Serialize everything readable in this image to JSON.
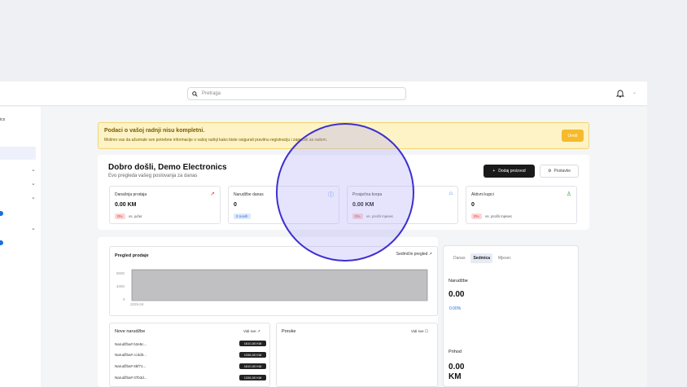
{
  "header": {
    "search_placeholder": "Pretraga",
    "search_icon": "search-icon",
    "bell_icon": "bell-icon",
    "chevron_icon": "chevron-down-icon"
  },
  "sidebar": {
    "company": "ics"
  },
  "alert": {
    "title": "Podaci o vašoj radnji nisu kompletni.",
    "message": "Molimo vas da ažurirate sve potrebne informacije o vašoj radnji kako biste osigurali pravilnu registraciju i započeli sa radom.",
    "button": "Uredi"
  },
  "welcome": {
    "title": "Dobro došli, Demo Electronics",
    "subtitle": "Evo pregleda vašeg poslovanja za danas",
    "add_product": "Dodaj proizvod",
    "settings": "Postavke"
  },
  "stats": [
    {
      "label": "Današnja prodaja",
      "value": "0.00 KM",
      "badge": "0%",
      "compare": "vs. jučer",
      "icon": "trend-up-icon"
    },
    {
      "label": "Narudžbe danas",
      "value": "0",
      "badge": "0 novih",
      "compare": "",
      "icon": "info-circle-icon"
    },
    {
      "label": "Prosječna korpa",
      "value": "0.00 KM",
      "badge": "0%",
      "compare": "vs. prošli mjesec",
      "icon": "bag-icon"
    },
    {
      "label": "Aktivni kupci",
      "value": "0",
      "badge": "0%",
      "compare": "vs. prošli mjesec",
      "icon": "user-icon"
    }
  ],
  "sales_chart": {
    "title": "Pregled prodaje",
    "period_link": "Sedmični pregled",
    "chart_data": {
      "type": "area",
      "x": [
        "2025-04"
      ],
      "y_ticks": [
        0,
        4000,
        8000
      ],
      "ylim": [
        0,
        8000
      ],
      "tick_labels": [
        "8000",
        "4000",
        "0"
      ],
      "x_label_text": "2025-04"
    }
  },
  "orders": {
    "title": "Nove narudžbe",
    "view_all": "Vidi sve",
    "rows": [
      {
        "id": "Narudžba# b2e5c...",
        "amount": "1610,00 KM"
      },
      {
        "id": "Narudžba# cc3d3...",
        "amount": "1336,00 KM"
      },
      {
        "id": "Narudžba# 6bf71...",
        "amount": "1610,00 KM"
      },
      {
        "id": "Narudžba# 07b3d...",
        "amount": "1336,00 KM"
      }
    ]
  },
  "messages": {
    "title": "Poruke",
    "view_all": "Vidi sve"
  },
  "right_panel": {
    "tabs": [
      "Danas",
      "Sedmica",
      "Mjesec"
    ],
    "orders_label": "Narudžbe",
    "orders_value": "0.00",
    "orders_pct": "0.00%",
    "income_label": "Prihod",
    "income_value": "0.00",
    "income_unit": "KM"
  },
  "colors": {
    "accent_blue": "#1e6fd9",
    "alert_bg": "#fdf3c6",
    "alert_button": "#f6bb2b",
    "highlight_circle": "#3d2fd0"
  }
}
